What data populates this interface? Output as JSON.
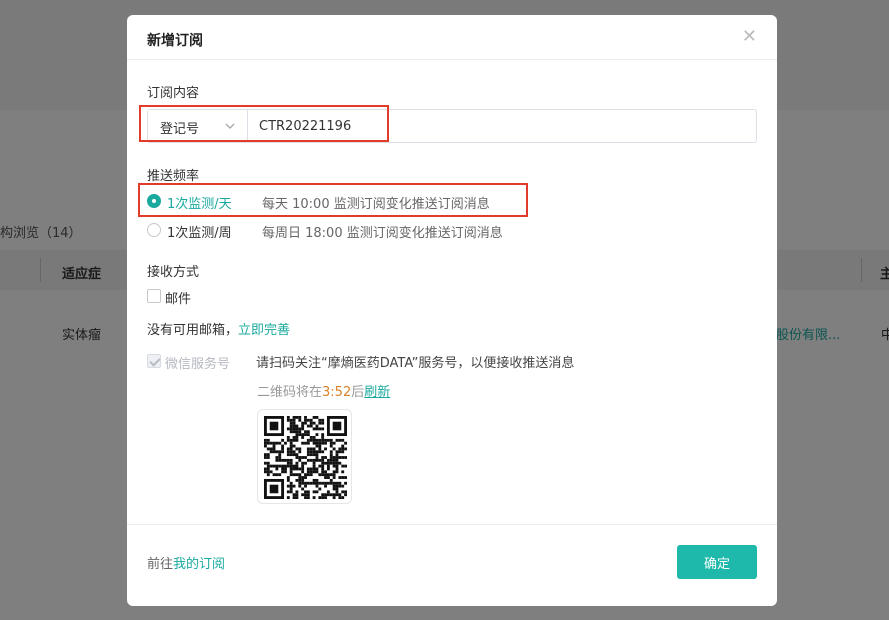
{
  "background": {
    "stats_text": "构浏览（14）",
    "table_headers": [
      "适应症",
      "主"
    ],
    "row": {
      "indication": "实体瘤",
      "company": "股份有限...",
      "tail": "中"
    }
  },
  "modal": {
    "title": "新增订阅",
    "close_icon": "close-icon",
    "content_section": {
      "label": "订阅内容",
      "select_value": "登记号",
      "input_value": "CTR20221196"
    },
    "frequency_section": {
      "label": "推送频率",
      "options": [
        {
          "label": "1次监测/天",
          "desc": "每天 10:00 监测订阅变化推送订阅消息",
          "selected": true
        },
        {
          "label": "1次监测/周",
          "desc": "每周日 18:00 监测订阅变化推送订阅消息",
          "selected": false
        }
      ]
    },
    "receive_section": {
      "label": "接收方式",
      "email_label": "邮件",
      "no_email_text": "没有可用邮箱，",
      "complete_link": "立即完善",
      "wechat_label": "微信服务号",
      "wechat_tip": "请扫码关注“摩熵医药DATA”服务号，以便接收推送消息",
      "qr_prefix": "二维码将在",
      "qr_countdown": "3:52",
      "qr_suffix": "后",
      "refresh_label": "刷新"
    },
    "footer": {
      "goto_prefix": "前往",
      "goto_link": "我的订阅",
      "ok_label": "确定"
    }
  },
  "colors": {
    "accent": "#1aa99e",
    "button": "#1fb9ab",
    "highlight_border": "#e33b2a",
    "countdown": "#d9822b"
  }
}
